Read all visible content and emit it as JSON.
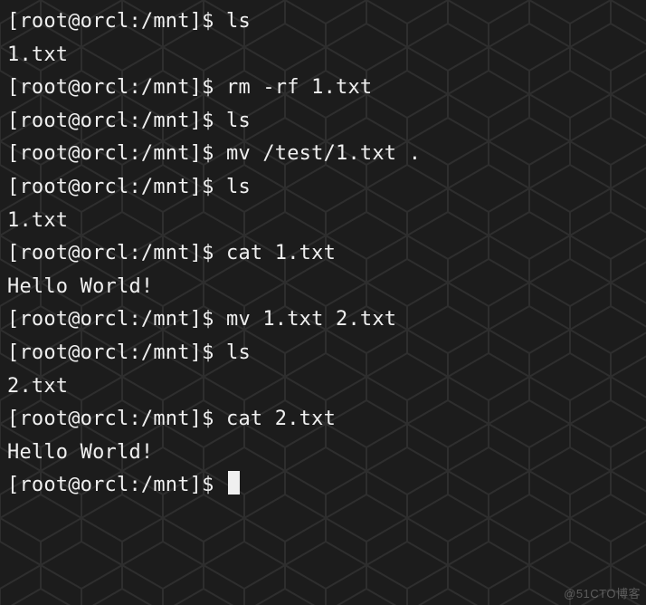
{
  "prompt": "[root@orcl:/mnt]$ ",
  "lines": [
    {
      "type": "cmd",
      "text": "ls"
    },
    {
      "type": "out",
      "text": "1.txt"
    },
    {
      "type": "cmd",
      "text": "rm -rf 1.txt"
    },
    {
      "type": "cmd",
      "text": "ls"
    },
    {
      "type": "cmd",
      "text": "mv /test/1.txt ."
    },
    {
      "type": "cmd",
      "text": "ls"
    },
    {
      "type": "out",
      "text": "1.txt"
    },
    {
      "type": "cmd",
      "text": "cat 1.txt"
    },
    {
      "type": "out",
      "text": "Hello World!"
    },
    {
      "type": "cmd",
      "text": "mv 1.txt 2.txt"
    },
    {
      "type": "cmd",
      "text": "ls"
    },
    {
      "type": "out",
      "text": "2.txt"
    },
    {
      "type": "cmd",
      "text": "cat 2.txt"
    },
    {
      "type": "out",
      "text": "Hello World!"
    },
    {
      "type": "cmd",
      "text": "",
      "cursor": true
    }
  ],
  "watermark": "@51CTO博客"
}
